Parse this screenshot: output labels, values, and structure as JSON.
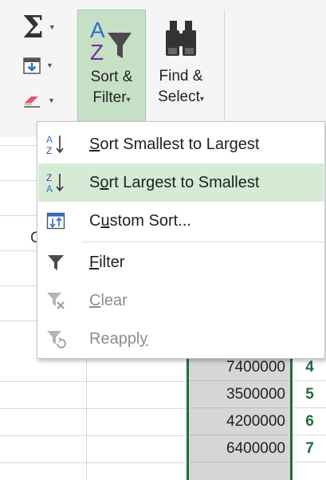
{
  "ribbon": {
    "autosum_icon": "sigma-icon",
    "sort_filter": {
      "line1": "Sort &",
      "line2": "Filter",
      "dropdown": "▾"
    },
    "find_select": {
      "line1": "Find &",
      "line2": "Select",
      "dropdown": "▾"
    }
  },
  "menu": {
    "items": [
      {
        "pre": "",
        "key": "S",
        "post": "ort Smallest to Largest",
        "icon": "sort-az-icon",
        "enabled": true
      },
      {
        "pre": "S",
        "key": "o",
        "post": "rt Largest to Smallest",
        "icon": "sort-za-icon",
        "enabled": true,
        "hover": true
      },
      {
        "pre": "C",
        "key": "u",
        "post": "stom Sort...",
        "icon": "custom-sort-icon",
        "enabled": true
      },
      {
        "pre": "",
        "key": "F",
        "post": "ilter",
        "icon": "filter-icon",
        "enabled": true
      },
      {
        "pre": "",
        "key": "C",
        "post": "lear",
        "icon": "clear-filter-icon",
        "enabled": false
      },
      {
        "pre": "Reappl",
        "key": "y",
        "post": "",
        "icon": "reapply-icon",
        "enabled": false
      }
    ]
  },
  "grid": {
    "partial_text": "C",
    "rows": [
      {
        "value": "7400000",
        "rank": "4"
      },
      {
        "value": "3500000",
        "rank": "5"
      },
      {
        "value": "4200000",
        "rank": "6"
      },
      {
        "value": "6400000",
        "rank": "7"
      }
    ]
  },
  "colors": {
    "sort_highlight": "#c6e0c6",
    "menu_hover": "#d5ebd5",
    "excel_green": "#1e6f3a",
    "selection_gray": "#d6d6d6"
  }
}
